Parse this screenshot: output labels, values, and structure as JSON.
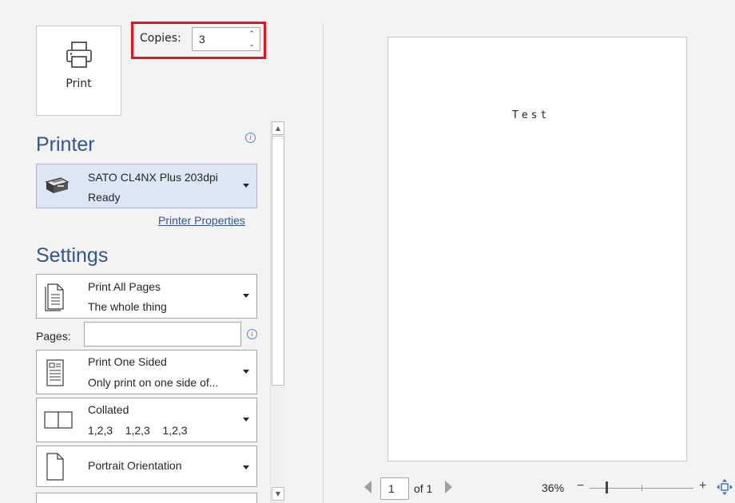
{
  "print_button": {
    "label": "Print",
    "icon": "printer-icon"
  },
  "copies": {
    "label": "Copies:",
    "value": "3"
  },
  "printer_section": {
    "title": "Printer",
    "printer_name": "SATO CL4NX Plus 203dpi",
    "printer_status": "Ready",
    "properties_link": "Printer Properties"
  },
  "settings_section": {
    "title": "Settings",
    "print_range": {
      "title": "Print All Pages",
      "subtitle": "The whole thing"
    },
    "pages_label": "Pages:",
    "pages_value": "",
    "sides": {
      "title": "Print One Sided",
      "subtitle": "Only print on one side of..."
    },
    "collation": {
      "title": "Collated",
      "subtitle": "1,2,3    1,2,3    1,2,3"
    },
    "orientation": {
      "title": "Portrait Orientation"
    }
  },
  "preview": {
    "page_text": "Test",
    "current_page": "1",
    "page_total": "of 1",
    "zoom": "36%",
    "zoom_minus": "−",
    "zoom_plus": "+"
  },
  "colors": {
    "accent": "#2f5597",
    "highlight_box": "#e0181e",
    "selected_printer_bg": "#dce6f4"
  }
}
